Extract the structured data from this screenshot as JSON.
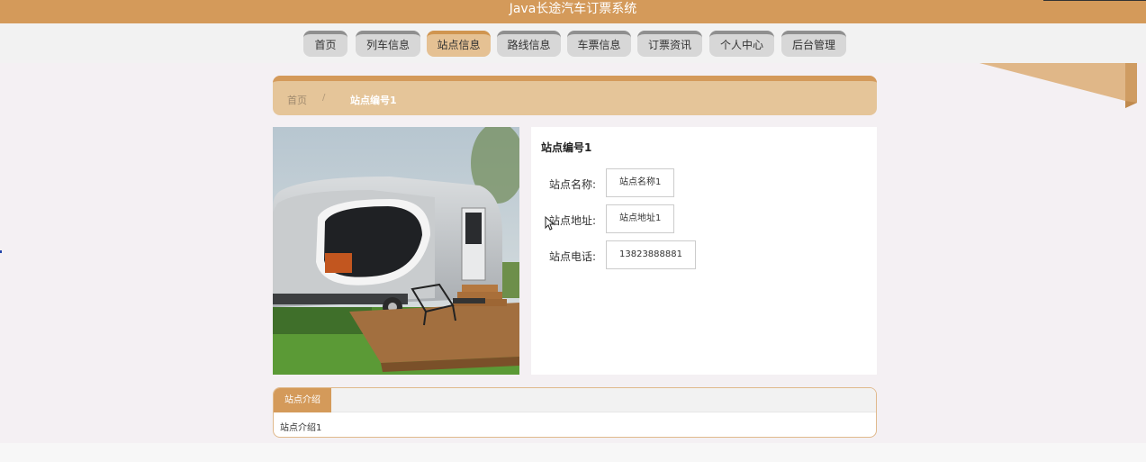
{
  "header": {
    "title": "Java长途汽车订票系统"
  },
  "nav": {
    "items": [
      {
        "label": "首页"
      },
      {
        "label": "列车信息"
      },
      {
        "label": "站点信息",
        "active": true
      },
      {
        "label": "路线信息"
      },
      {
        "label": "车票信息"
      },
      {
        "label": "订票资讯"
      },
      {
        "label": "个人中心"
      },
      {
        "label": "后台管理"
      }
    ]
  },
  "breadcrumb": {
    "home": "首页",
    "separator": "/",
    "current": "站点编号1"
  },
  "detail": {
    "title": "站点编号1",
    "fields": [
      {
        "label": "站点名称:",
        "value": "站点名称1"
      },
      {
        "label": "站点地址:",
        "value": "站点地址1"
      },
      {
        "label": "站点电话:",
        "value": "13823888881"
      }
    ]
  },
  "tabs": {
    "active_label": "站点介绍",
    "content": "站点介绍1"
  },
  "colors": {
    "brand": "#d49a5a",
    "active_nav": "#e5c193",
    "breadcrumb_bg": "#e5c599",
    "page_bg": "#f4f0f3"
  }
}
